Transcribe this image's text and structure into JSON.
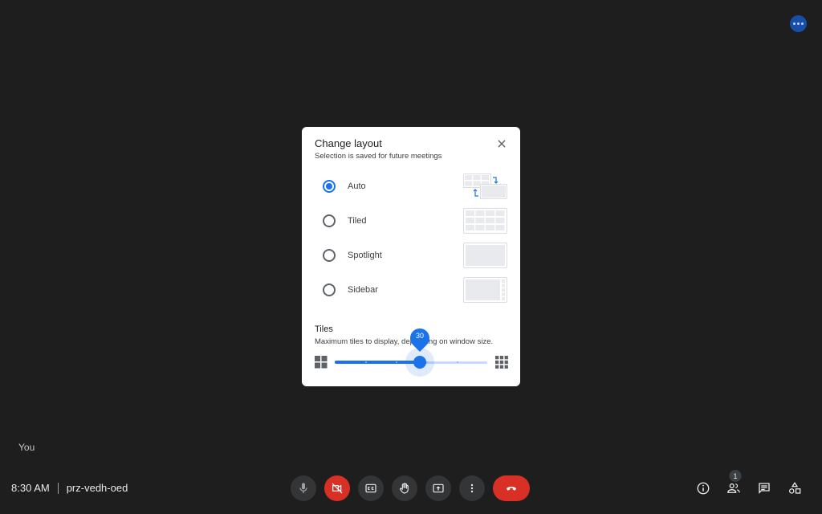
{
  "meeting": {
    "time": "8:30 AM",
    "code": "prz-vedh-oed",
    "self_label": "You",
    "participants_count": "1"
  },
  "dialog": {
    "title": "Change layout",
    "subtitle": "Selection is saved for future meetings",
    "options": [
      {
        "label": "Auto",
        "selected": true
      },
      {
        "label": "Tiled",
        "selected": false
      },
      {
        "label": "Spotlight",
        "selected": false
      },
      {
        "label": "Sidebar",
        "selected": false
      }
    ],
    "tiles": {
      "title": "Tiles",
      "description": "Maximum tiles to display, depending on window size.",
      "value": "30",
      "min": 6,
      "max": 49
    }
  },
  "icons": {
    "top_more": "more-horiz-icon",
    "mic": "mic-icon",
    "camera": "videocam-off-icon",
    "captions": "closed-caption-icon",
    "raise_hand": "hand-icon",
    "present": "present-to-all-icon",
    "more": "more-vert-icon",
    "end_call": "call-end-icon",
    "info": "info-icon",
    "people": "people-icon",
    "chat": "chat-icon",
    "activities": "shapes-icon",
    "close": "close-icon"
  },
  "colors": {
    "background": "#1e1e1e",
    "accent": "#1a73e8",
    "danger": "#d93025",
    "dialog_bg": "#ffffff"
  }
}
